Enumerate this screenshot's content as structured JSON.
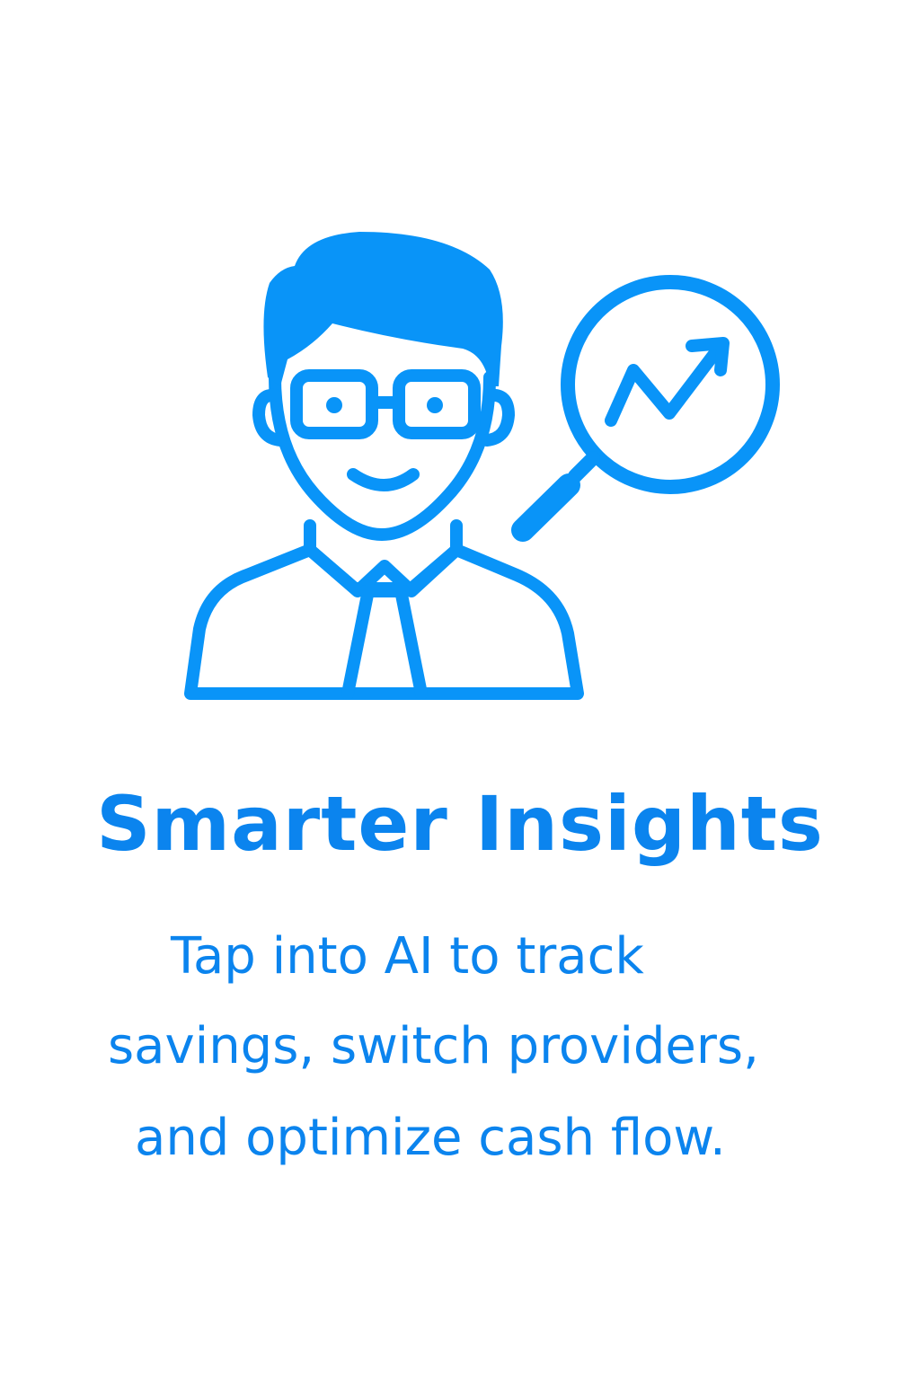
{
  "colors": {
    "accent": "#0b84ee",
    "icon": "#0994f8",
    "background": "#ffffff"
  },
  "illustration": {
    "person_icon": "businessman-with-glasses-icon",
    "magnifier_icon": "magnifying-glass-trend-up-icon"
  },
  "title": "Smarter Insights",
  "description": {
    "lines": [
      "Tap into AI to track",
      "savings, switch providers,",
      "and optimize cash flow."
    ]
  }
}
